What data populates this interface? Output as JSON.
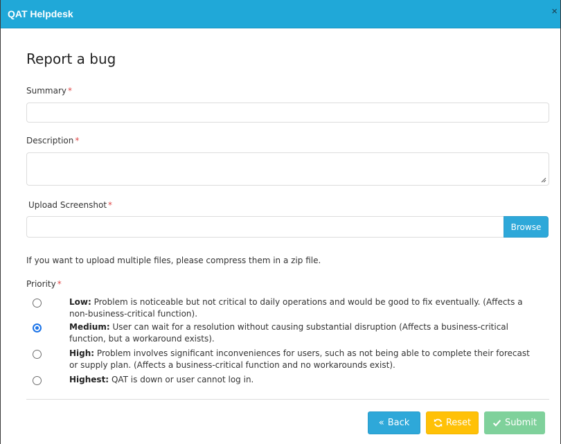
{
  "header": {
    "title": "QAT Helpdesk",
    "close": "×"
  },
  "form": {
    "title": "Report a bug",
    "required_marker": "*",
    "summary_label": "Summary",
    "description_label": "Description",
    "upload_label": "Upload Screenshot",
    "browse_label": "Browse",
    "hint": "If you want to upload multiple files, please compress them in a zip file.",
    "priority_label": "Priority",
    "priorities": [
      {
        "name": "Low:",
        "text": "Problem is noticeable but not critical to daily operations and would be good to fix eventually. (Affects a non-business-critical function).",
        "checked": false
      },
      {
        "name": "Medium:",
        "text": "User can wait for a resolution without causing substantial disruption (Affects a business-critical function, but a workaround exists).",
        "checked": true
      },
      {
        "name": "High:",
        "text": "Problem involves significant inconveniences for users, such as not being able to complete their forecast or supply plan. (Affects a business-critical function and no workarounds exist).",
        "checked": false
      },
      {
        "name": "Highest:",
        "text": "QAT is down or user cannot log in.",
        "checked": false
      }
    ]
  },
  "buttons": {
    "back": "Back",
    "reset": "Reset",
    "submit": "Submit"
  },
  "colors": {
    "header": "#20a8d8",
    "primary": "#2ea8d9",
    "warning": "#ffc107",
    "success": "#7fd19b",
    "required": "#e04848"
  }
}
